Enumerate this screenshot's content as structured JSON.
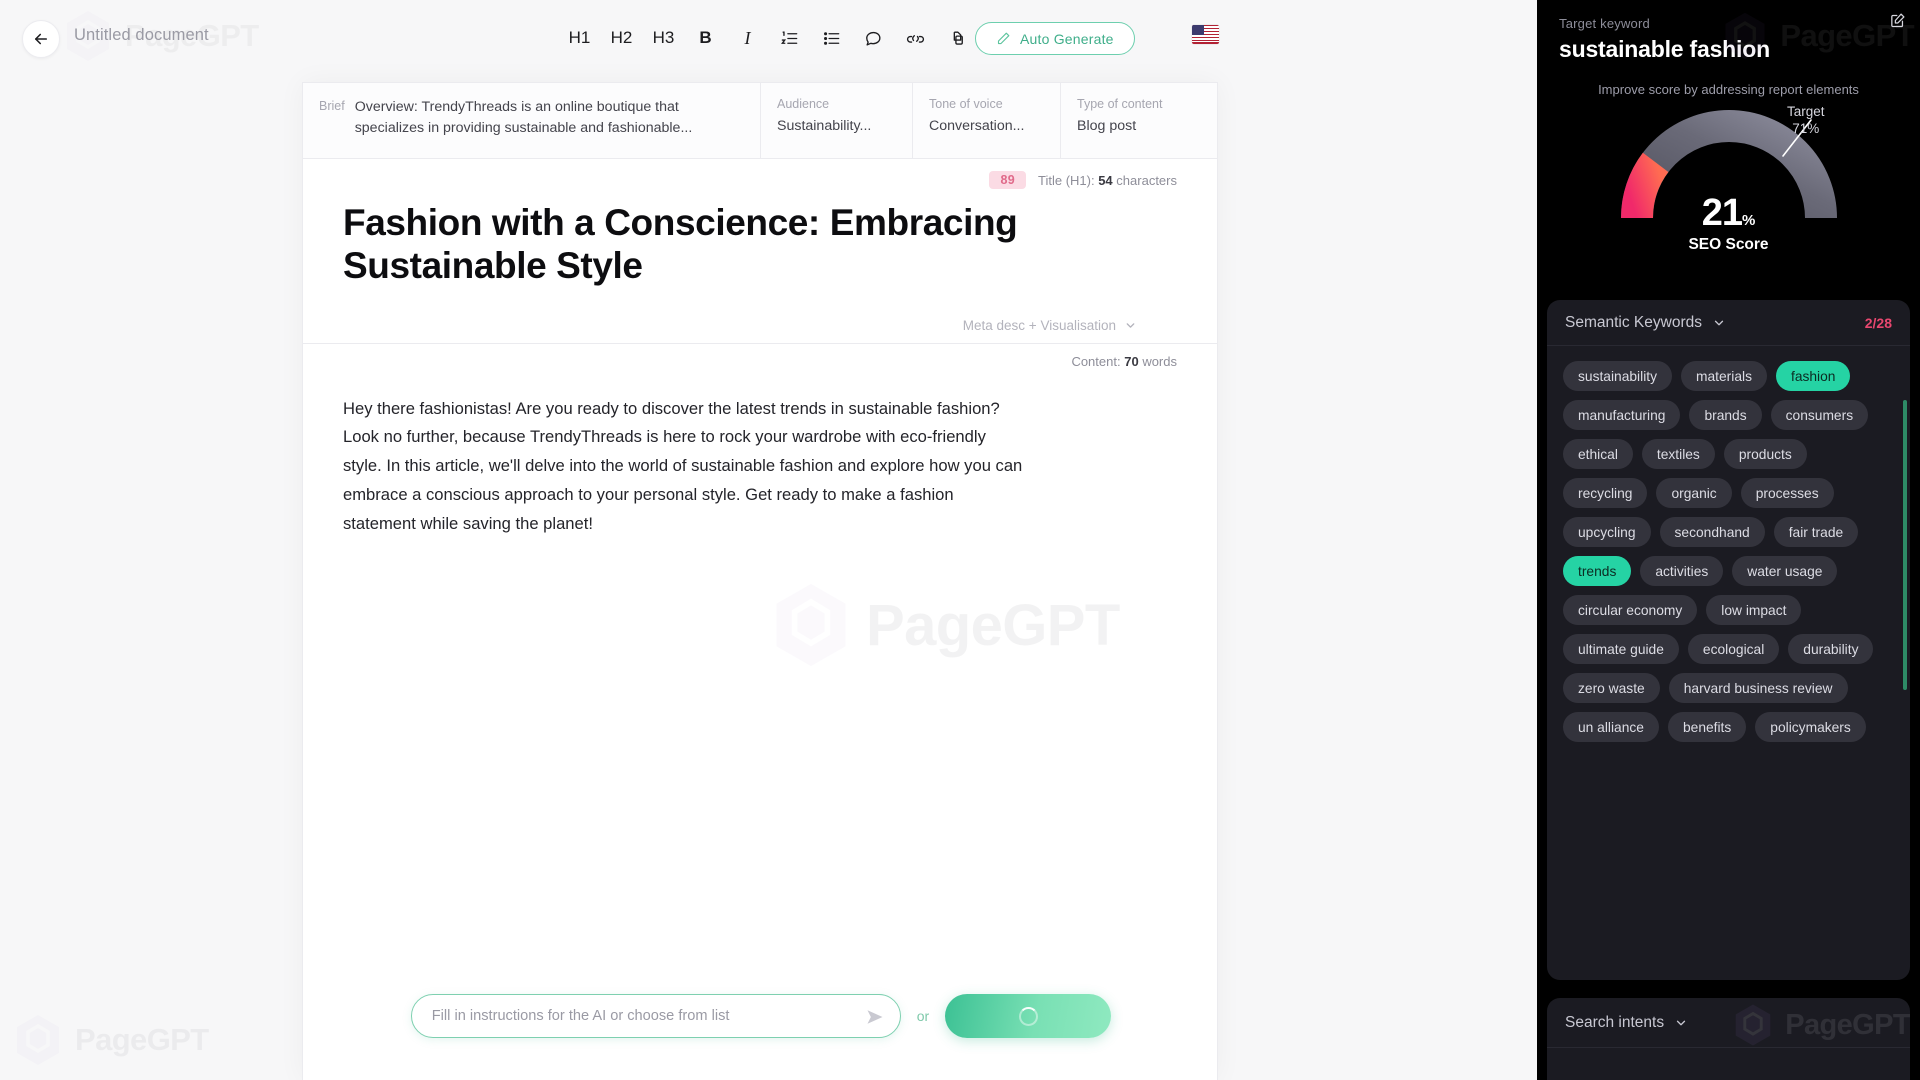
{
  "topbar": {
    "back_icon": "arrow-left-icon",
    "document_title": "Untitled document",
    "format_tools": [
      {
        "name": "h1",
        "label": "H1"
      },
      {
        "name": "h2",
        "label": "H2"
      },
      {
        "name": "h3",
        "label": "H3"
      },
      {
        "name": "bold",
        "label": "B"
      },
      {
        "name": "italic",
        "label": "I"
      },
      {
        "name": "ordered-list",
        "label": ""
      },
      {
        "name": "bullet-list",
        "label": ""
      },
      {
        "name": "comment",
        "label": ""
      },
      {
        "name": "link",
        "label": ""
      },
      {
        "name": "copy",
        "label": ""
      }
    ],
    "auto_generate_label": "Auto Generate",
    "auto_generate_icon": "pencil-icon",
    "language_flag": "us-flag-icon"
  },
  "brief": {
    "key_label": "Brief",
    "overview_text": "Overview: TrendyThreads is an online boutique that specializes in providing sustainable and fashionable...",
    "audience_label": "Audience",
    "audience_value": "Sustainability...",
    "tone_label": "Tone of voice",
    "tone_value": "Conversation...",
    "type_label": "Type of content",
    "type_value": "Blog post"
  },
  "document": {
    "title_score": "89",
    "title_meta_prefix": "Title (H1):",
    "title_meta_count": "54",
    "title_meta_suffix": "characters",
    "h1": "Fashion with a Conscience: Embracing Sustainable Style",
    "metadesc_label": "Meta desc + Visualisation",
    "metadesc_chevron": "chevron-down-icon",
    "content_prefix": "Content:",
    "content_count": "70",
    "content_suffix": "words",
    "body": "Hey there fashionistas! Are you ready to discover the latest trends in sustainable fashion? Look no further, because TrendyThreads is here to rock your wardrobe with eco-friendly style. In this article, we'll delve into the world of sustainable fashion and explore how you can embrace a conscious approach to your personal style. Get ready to make a fashion statement while saving the planet!",
    "watermark": "PageGPT"
  },
  "prompt": {
    "placeholder": "Fill in instructions for the AI or choose from list",
    "value": "",
    "send_icon": "send-icon",
    "or_label": "or",
    "generate_state": "loading-spinner-icon"
  },
  "panel": {
    "target_keyword_label": "Target keyword",
    "target_keyword": "sustainable fashion",
    "edit_icon": "edit-square-icon",
    "watermark": "PageGPT",
    "gauge": {
      "score": "21",
      "score_unit": "%",
      "score_label": "SEO Score",
      "target_label": "Target",
      "target_value": "71%",
      "hint": "Improve score by addressing report elements",
      "low_color": "#f0365f",
      "track_color": "#5b5b68"
    },
    "semantic_keywords": {
      "title": "Semantic Keywords",
      "chevron": "chevron-down-icon",
      "count": "2/28",
      "count_color": "#e8476f",
      "active_color": "#25d3a4",
      "chips": [
        {
          "label": "sustainability",
          "active": false
        },
        {
          "label": "materials",
          "active": false
        },
        {
          "label": "fashion",
          "active": true
        },
        {
          "label": "manufacturing",
          "active": false
        },
        {
          "label": "brands",
          "active": false
        },
        {
          "label": "consumers",
          "active": false
        },
        {
          "label": "ethical",
          "active": false
        },
        {
          "label": "textiles",
          "active": false
        },
        {
          "label": "products",
          "active": false
        },
        {
          "label": "recycling",
          "active": false
        },
        {
          "label": "organic",
          "active": false
        },
        {
          "label": "processes",
          "active": false
        },
        {
          "label": "upcycling",
          "active": false
        },
        {
          "label": "secondhand",
          "active": false
        },
        {
          "label": "fair trade",
          "active": false
        },
        {
          "label": "trends",
          "active": true
        },
        {
          "label": "activities",
          "active": false
        },
        {
          "label": "water usage",
          "active": false
        },
        {
          "label": "circular economy",
          "active": false
        },
        {
          "label": "low impact",
          "active": false
        },
        {
          "label": "ultimate guide",
          "active": false
        },
        {
          "label": "ecological",
          "active": false
        },
        {
          "label": "durability",
          "active": false
        },
        {
          "label": "zero waste",
          "active": false
        },
        {
          "label": "harvard business review",
          "active": false
        },
        {
          "label": "un alliance",
          "active": false
        },
        {
          "label": "benefits",
          "active": false
        },
        {
          "label": "policymakers",
          "active": false
        }
      ]
    },
    "search_intents": {
      "title": "Search intents",
      "chevron": "chevron-down-icon"
    }
  }
}
